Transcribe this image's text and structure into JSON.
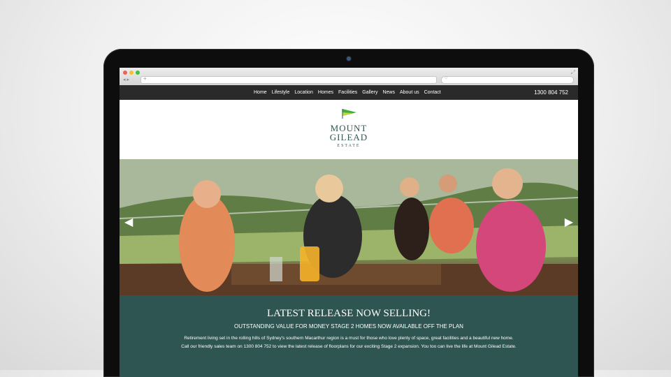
{
  "nav": {
    "items": [
      "Home",
      "Lifestyle",
      "Location",
      "Homes",
      "Facilities",
      "Gallery",
      "News",
      "About us",
      "Contact"
    ],
    "phone": "1300 804 752"
  },
  "brand": {
    "line1": "MOUNT",
    "line2": "GILEAD",
    "line3": "ESTATE",
    "colors": {
      "primary": "#2e5552",
      "flag_green": "#3fae3a",
      "flag_yellow": "#c8d43a"
    }
  },
  "hero": {
    "icon_left": "chevron-left-icon",
    "icon_right": "chevron-right-icon"
  },
  "banner": {
    "headline": "LATEST RELEASE NOW SELLING!",
    "subheadline": "OUTSTANDING VALUE FOR MONEY STAGE 2 HOMES NOW AVAILABLE OFF THE PLAN",
    "body": "Retirement living set in the rolling hills of Sydney's southern Macarthur region is a must for those who love plenty of space, great facilities and a beautiful new home. Call our friendly sales team on 1300 804 752 to view the latest release of floorplans for our exciting Stage 2 expansion. You too can live the life at Mount Gilead Estate."
  }
}
